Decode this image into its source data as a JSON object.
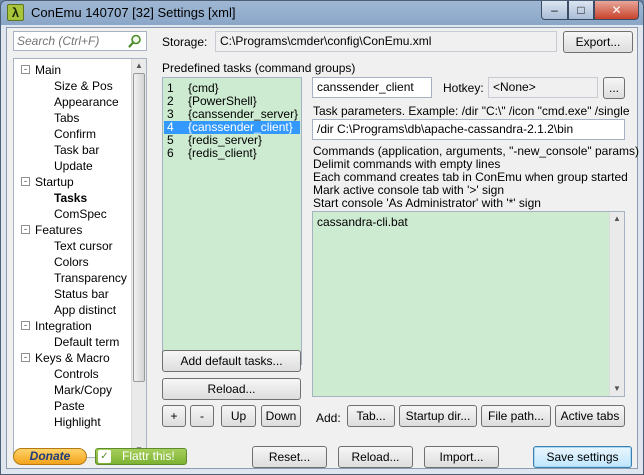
{
  "window": {
    "title": "ConEmu 140707 [32] Settings [xml]",
    "icon_glyph": "λ",
    "buttons": {
      "minimize": "‒",
      "maximize": "□",
      "close": "✕"
    }
  },
  "search": {
    "placeholder": "Search (Ctrl+F)"
  },
  "tree": [
    {
      "label": "Main",
      "level": 0,
      "expander": "-"
    },
    {
      "label": "Size & Pos",
      "level": 1
    },
    {
      "label": "Appearance",
      "level": 1
    },
    {
      "label": "Tabs",
      "level": 1
    },
    {
      "label": "Confirm",
      "level": 1
    },
    {
      "label": "Task bar",
      "level": 1
    },
    {
      "label": "Update",
      "level": 1
    },
    {
      "label": "Startup",
      "level": 0,
      "expander": "-"
    },
    {
      "label": "Tasks",
      "level": 1,
      "selected": true
    },
    {
      "label": "ComSpec",
      "level": 1
    },
    {
      "label": "Features",
      "level": 0,
      "expander": "-"
    },
    {
      "label": "Text cursor",
      "level": 1
    },
    {
      "label": "Colors",
      "level": 1
    },
    {
      "label": "Transparency",
      "level": 1
    },
    {
      "label": "Status bar",
      "level": 1
    },
    {
      "label": "App distinct",
      "level": 1
    },
    {
      "label": "Integration",
      "level": 0,
      "expander": "-"
    },
    {
      "label": "Default term",
      "level": 1
    },
    {
      "label": "Keys & Macro",
      "level": 0,
      "expander": "-"
    },
    {
      "label": "Controls",
      "level": 1
    },
    {
      "label": "Mark/Copy",
      "level": 1
    },
    {
      "label": "Paste",
      "level": 1
    },
    {
      "label": "Highlight",
      "level": 1
    }
  ],
  "storage": {
    "label": "Storage:",
    "path": "C:\\Programs\\cmder\\config\\ConEmu.xml",
    "export_button": "Export..."
  },
  "tasks": {
    "group_label": "Predefined tasks (command groups)",
    "items": [
      {
        "num": "1",
        "name": "{cmd}"
      },
      {
        "num": "2",
        "name": "{PowerShell}"
      },
      {
        "num": "3",
        "name": "{canssender_server}"
      },
      {
        "num": "4",
        "name": "{canssender_client}",
        "selected": true
      },
      {
        "num": "5",
        "name": "{redis_server}"
      },
      {
        "num": "6",
        "name": "{redis_client}"
      }
    ],
    "name_value": "canssender_client",
    "hotkey_label": "Hotkey:",
    "hotkey_value": "<None>",
    "hotkey_button": "...",
    "params_label": "Task parameters. Example: /dir \"C:\\\" /icon \"cmd.exe\" /single",
    "params_value": "/dir C:\\Programs\\db\\apache-cassandra-2.1.2\\bin",
    "commands_desc": [
      "Commands (application, arguments, \"-new_console\" params)",
      "Delimit commands with empty lines",
      "Each command creates tab in ConEmu when group started",
      "Mark active console tab with '>' sign",
      "Start console 'As Administrator' with '*' sign"
    ],
    "commands_value": "cassandra-cli.bat",
    "add_default_button": "Add default tasks...",
    "reload_button": "Reload...",
    "plus_button": "+",
    "minus_button": "-",
    "up_button": "Up",
    "down_button": "Down",
    "add_label": "Add:",
    "tab_button": "Tab...",
    "startup_dir_button": "Startup dir...",
    "file_path_button": "File path...",
    "active_tabs_button": "Active tabs"
  },
  "footer": {
    "donate": "Donate",
    "flattr": "Flattr this!",
    "reset": "Reset...",
    "reload": "Reload...",
    "import": "Import...",
    "save": "Save settings"
  }
}
